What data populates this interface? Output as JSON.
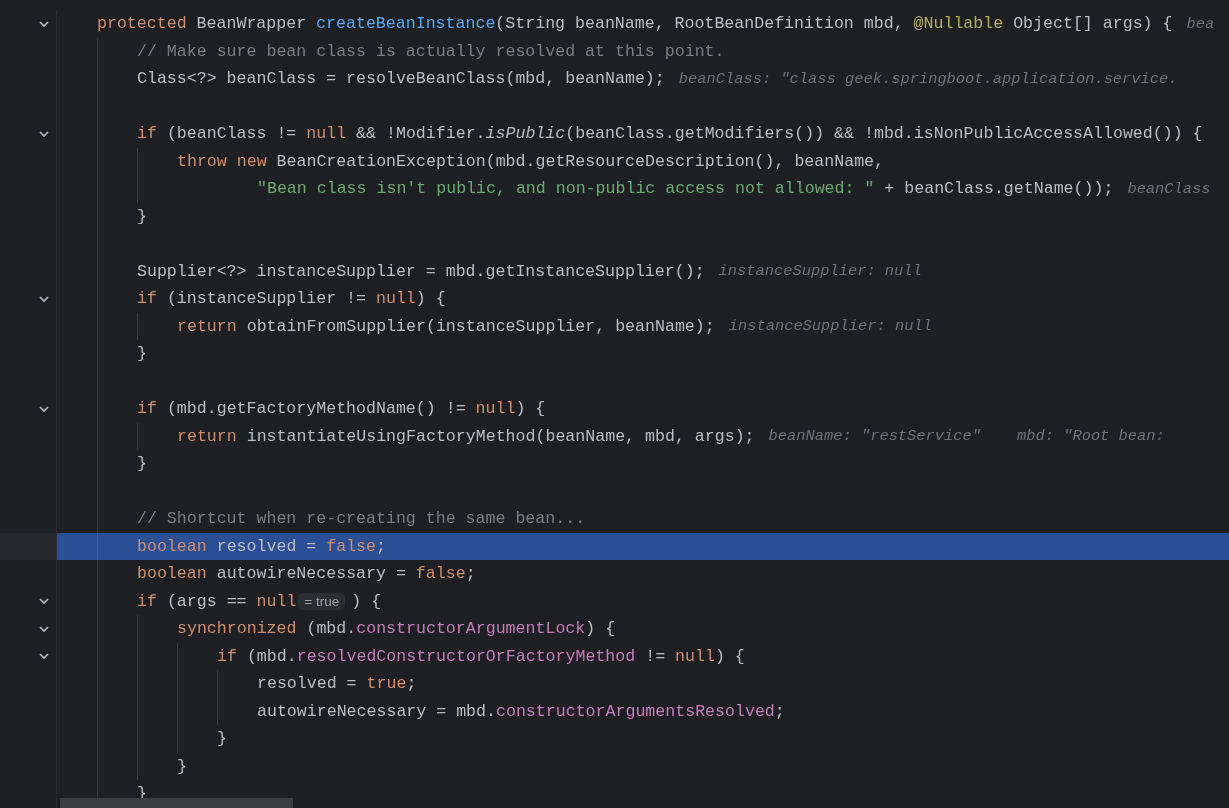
{
  "editor": {
    "lines": [
      {
        "kind": "code",
        "selected": false,
        "expanded": true,
        "tokens": [
          {
            "kind": "keyword",
            "text": "protected "
          },
          {
            "kind": "plain",
            "text": "BeanWrapper "
          },
          {
            "kind": "declaration",
            "text": "createBeanInstance"
          },
          {
            "kind": "plain",
            "text": "(String beanName, RootBeanDefinition mbd, "
          },
          {
            "kind": "annotation",
            "text": "@Nullable"
          },
          {
            "kind": "plain",
            "text": " Object[] args) {"
          }
        ],
        "hints": [
          "bea"
        ],
        "children": [
          {
            "kind": "code",
            "selected": false,
            "tokens": [
              {
                "kind": "comment",
                "text": "// Make sure bean class is actually resolved at this point."
              }
            ]
          },
          {
            "kind": "code",
            "selected": false,
            "tokens": [
              {
                "kind": "plain",
                "text": "Class<?> beanClass = resolveBeanClass(mbd, beanName);"
              }
            ],
            "hints": [
              "beanClass: \"class geek.springboot.application.service."
            ]
          },
          {
            "kind": "blank",
            "selected": false
          },
          {
            "kind": "code",
            "selected": false,
            "expanded": true,
            "tokens": [
              {
                "kind": "keyword",
                "text": "if"
              },
              {
                "kind": "plain",
                "text": " (beanClass != "
              },
              {
                "kind": "keyword",
                "text": "null"
              },
              {
                "kind": "plain",
                "text": " && !Modifier."
              },
              {
                "kind": "static-call",
                "text": "isPublic"
              },
              {
                "kind": "plain",
                "text": "(beanClass.getModifiers()) && !mbd.isNonPublicAccessAllowed()) {"
              }
            ],
            "children": [
              {
                "kind": "code",
                "selected": false,
                "tokens": [
                  {
                    "kind": "keyword",
                    "text": "throw new"
                  },
                  {
                    "kind": "plain",
                    "text": " BeanCreationException(mbd.getResourceDescription(), beanName,"
                  }
                ]
              },
              {
                "kind": "continuation",
                "selected": false,
                "tokens": [
                  {
                    "kind": "string",
                    "text": "\"Bean class isn't public, and non-public access not allowed: \""
                  },
                  {
                    "kind": "plain",
                    "text": " + beanClass.getName());"
                  }
                ],
                "hints": [
                  "beanClass"
                ]
              }
            ]
          },
          {
            "kind": "code",
            "selected": false,
            "tokens": [
              {
                "kind": "plain",
                "text": "}"
              }
            ]
          },
          {
            "kind": "blank",
            "selected": false
          },
          {
            "kind": "code",
            "selected": false,
            "tokens": [
              {
                "kind": "plain",
                "text": "Supplier<?> instanceSupplier = mbd.getInstanceSupplier();"
              }
            ],
            "hints": [
              "instanceSupplier: null"
            ]
          },
          {
            "kind": "code",
            "selected": false,
            "expanded": true,
            "tokens": [
              {
                "kind": "keyword",
                "text": "if"
              },
              {
                "kind": "plain",
                "text": " (instanceSupplier != "
              },
              {
                "kind": "keyword",
                "text": "null"
              },
              {
                "kind": "plain",
                "text": ") {"
              }
            ],
            "children": [
              {
                "kind": "code",
                "selected": false,
                "tokens": [
                  {
                    "kind": "keyword",
                    "text": "return"
                  },
                  {
                    "kind": "plain",
                    "text": " obtainFromSupplier(instanceSupplier, beanName);"
                  }
                ],
                "hints": [
                  "instanceSupplier: null"
                ]
              }
            ]
          },
          {
            "kind": "code",
            "selected": false,
            "tokens": [
              {
                "kind": "plain",
                "text": "}"
              }
            ]
          },
          {
            "kind": "blank",
            "selected": false
          },
          {
            "kind": "code",
            "selected": false,
            "expanded": true,
            "tokens": [
              {
                "kind": "keyword",
                "text": "if"
              },
              {
                "kind": "plain",
                "text": " (mbd.getFactoryMethodName() != "
              },
              {
                "kind": "keyword",
                "text": "null"
              },
              {
                "kind": "plain",
                "text": ") {"
              }
            ],
            "children": [
              {
                "kind": "code",
                "selected": false,
                "tokens": [
                  {
                    "kind": "keyword",
                    "text": "return"
                  },
                  {
                    "kind": "plain",
                    "text": " instantiateUsingFactoryMethod(beanName, mbd, args);"
                  }
                ],
                "hints": [
                  "beanName: \"restService\"",
                  "mbd: \"Root bean:"
                ]
              }
            ]
          },
          {
            "kind": "code",
            "selected": false,
            "tokens": [
              {
                "kind": "plain",
                "text": "}"
              }
            ]
          },
          {
            "kind": "blank",
            "selected": false
          },
          {
            "kind": "code",
            "selected": false,
            "tokens": [
              {
                "kind": "comment",
                "text": "// Shortcut when re-creating the same bean..."
              }
            ]
          },
          {
            "kind": "code",
            "selected": true,
            "tokens": [
              {
                "kind": "keyword",
                "text": "boolean"
              },
              {
                "kind": "plain",
                "text": " resolved = "
              },
              {
                "kind": "keyword",
                "text": "false"
              },
              {
                "kind": "plain",
                "text": ";"
              }
            ]
          },
          {
            "kind": "code",
            "selected": false,
            "tokens": [
              {
                "kind": "keyword",
                "text": "boolean"
              },
              {
                "kind": "plain",
                "text": " autowireNecessary = "
              },
              {
                "kind": "keyword",
                "text": "false"
              },
              {
                "kind": "plain",
                "text": ";"
              }
            ]
          },
          {
            "kind": "code",
            "selected": false,
            "expanded": true,
            "tokens": [
              {
                "kind": "keyword",
                "text": "if"
              },
              {
                "kind": "plain",
                "text": " (args == "
              },
              {
                "kind": "keyword",
                "text": "null"
              },
              {
                "kind": "value",
                "text": "= true"
              },
              {
                "kind": "plain",
                "text": ") {"
              }
            ],
            "children": [
              {
                "kind": "code",
                "selected": false,
                "expanded": true,
                "tokens": [
                  {
                    "kind": "keyword",
                    "text": "synchronized"
                  },
                  {
                    "kind": "plain",
                    "text": " (mbd."
                  },
                  {
                    "kind": "field",
                    "text": "constructorArgumentLock"
                  },
                  {
                    "kind": "plain",
                    "text": ") {"
                  }
                ],
                "children": [
                  {
                    "kind": "code",
                    "selected": false,
                    "expanded": true,
                    "tokens": [
                      {
                        "kind": "keyword",
                        "text": "if"
                      },
                      {
                        "kind": "plain",
                        "text": " (mbd."
                      },
                      {
                        "kind": "field",
                        "text": "resolvedConstructorOrFactoryMethod"
                      },
                      {
                        "kind": "plain",
                        "text": " != "
                      },
                      {
                        "kind": "keyword",
                        "text": "null"
                      },
                      {
                        "kind": "plain",
                        "text": ") {"
                      }
                    ],
                    "children": [
                      {
                        "kind": "code",
                        "selected": false,
                        "tokens": [
                          {
                            "kind": "plain",
                            "text": "resolved = "
                          },
                          {
                            "kind": "keyword",
                            "text": "true"
                          },
                          {
                            "kind": "plain",
                            "text": ";"
                          }
                        ]
                      },
                      {
                        "kind": "code",
                        "selected": false,
                        "tokens": [
                          {
                            "kind": "plain",
                            "text": "autowireNecessary = mbd."
                          },
                          {
                            "kind": "field",
                            "text": "constructorArgumentsResolved"
                          },
                          {
                            "kind": "plain",
                            "text": ";"
                          }
                        ]
                      }
                    ]
                  },
                  {
                    "kind": "code",
                    "selected": false,
                    "tokens": [
                      {
                        "kind": "plain",
                        "text": "}"
                      }
                    ]
                  }
                ]
              },
              {
                "kind": "code",
                "selected": false,
                "tokens": [
                  {
                    "kind": "plain",
                    "text": "}"
                  }
                ]
              }
            ]
          },
          {
            "kind": "code",
            "selected": false,
            "tokens": [
              {
                "kind": "plain",
                "text": "}"
              }
            ]
          }
        ]
      }
    ]
  }
}
